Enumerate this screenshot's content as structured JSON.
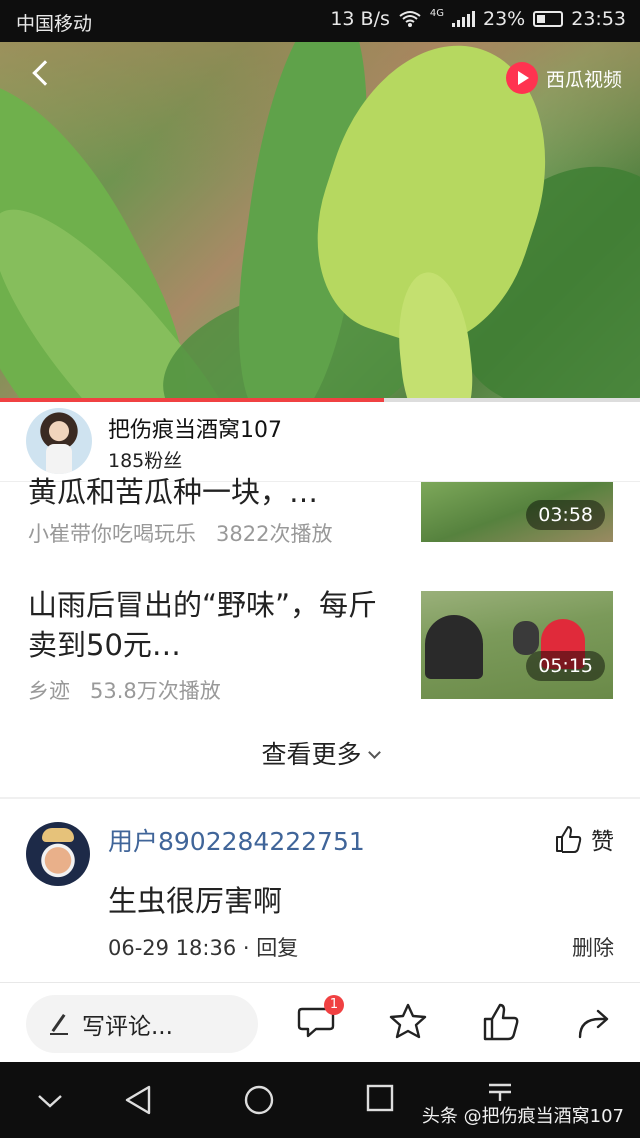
{
  "status_bar": {
    "carrier": "中国移动",
    "network_speed": "13 B/s",
    "network_type": "4G",
    "battery": "23%",
    "time": "23:53"
  },
  "video": {
    "brand": "西瓜视频",
    "progress": 0.6
  },
  "author": {
    "name": "把伤痕当酒窝107",
    "fans": "185粉丝"
  },
  "recommendations": [
    {
      "title": "黄瓜和苦瓜种一块，…",
      "source": "小崔带你吃喝玩乐",
      "plays": "3822次播放",
      "duration": "03:58"
    },
    {
      "title": "山雨后冒出的“野味”，每斤卖到50元…",
      "source": "乡迹",
      "plays": "53.8万次播放",
      "duration": "05:15"
    }
  ],
  "see_more": "查看更多",
  "comment": {
    "user": "用户8902284222751",
    "like_label": "赞",
    "text": "生虫很厉害啊",
    "time": "06-29 18:36",
    "separator": "·",
    "reply": "回复",
    "delete": "删除"
  },
  "bottom_bar": {
    "write_placeholder": "写评论...",
    "comment_count": "1"
  },
  "watermark": "头条 @把伤痕当酒窝107",
  "colors": {
    "accent": "#f04142",
    "username": "#406599",
    "brand": "#ff3350"
  }
}
